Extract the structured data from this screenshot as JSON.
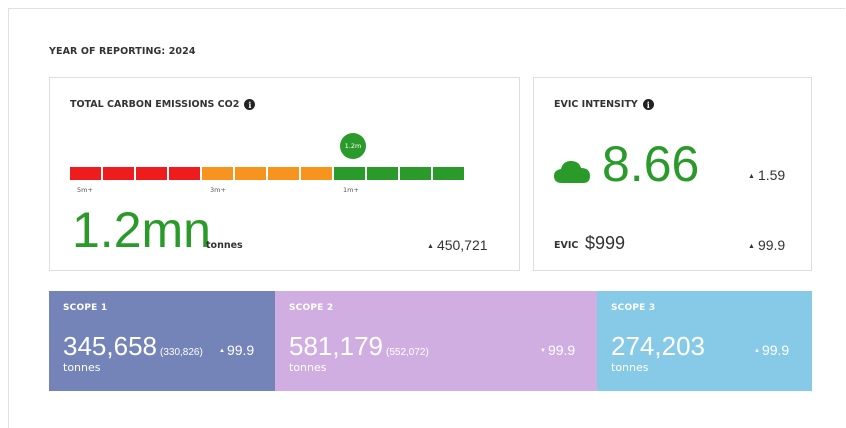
{
  "header": {
    "year_label": "YEAR OF REPORTING: 2024"
  },
  "total_card": {
    "title": "TOTAL CARBON EMISSIONS CO2",
    "scale_colors": [
      "#ee1c1c",
      "#ee1c1c",
      "#ee1c1c",
      "#ee1c1c",
      "#f7941d",
      "#f7941d",
      "#f7941d",
      "#f7941d",
      "#2a9a2a",
      "#2a9a2a",
      "#2a9a2a",
      "#2a9a2a"
    ],
    "scale_labels": {
      "low": "5m+",
      "mid": "3m+",
      "high": "1m+"
    },
    "marker_label": "1.2m",
    "value": "1.2mn",
    "unit": "tonnes",
    "delta": "450,721",
    "delta_direction": "up"
  },
  "evic_card": {
    "title": "EVIC INTENSITY",
    "icon": "cloud-icon",
    "value": "8.66",
    "delta": "1.59",
    "evic_label": "EVIC",
    "evic_value": "$999",
    "evic_delta": "99.9"
  },
  "scopes": [
    {
      "title": "SCOPE 1",
      "value": "345,658",
      "previous": "(330,826)",
      "delta": "99.9",
      "delta_direction": "up",
      "unit": "tonnes",
      "color": "#7483b8"
    },
    {
      "title": "SCOPE 2",
      "value": "581,179",
      "previous": "(552,072)",
      "delta": "99.9",
      "delta_direction": "down",
      "unit": "tonnes",
      "color": "#d0aee2"
    },
    {
      "title": "SCOPE 3",
      "value": "274,203",
      "previous": "",
      "delta": "99.9",
      "delta_direction": "up",
      "unit": "tonnes",
      "color": "#87cae8"
    }
  ],
  "colors": {
    "accent_green": "#2a9a2a"
  }
}
